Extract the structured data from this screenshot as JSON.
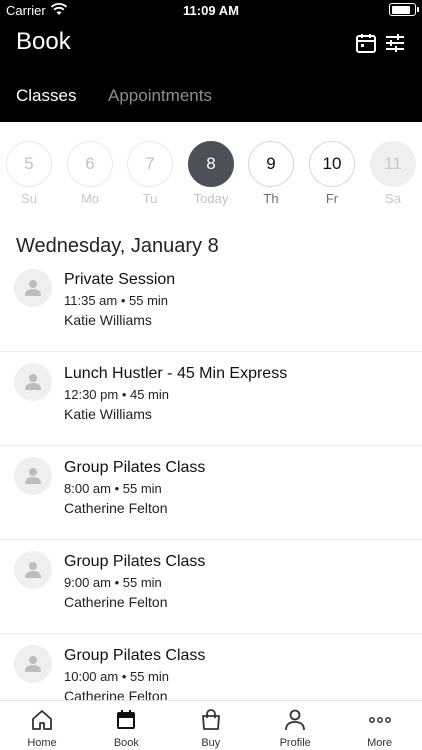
{
  "status_bar": {
    "carrier": "Carrier",
    "time": "11:09 AM",
    "battery_level": 0.9
  },
  "header": {
    "title": "Book",
    "icons": [
      "calendar-icon",
      "filter-sliders-icon"
    ],
    "tabs": [
      {
        "label": "Classes",
        "selected": true
      },
      {
        "label": "Appointments",
        "selected": false
      }
    ]
  },
  "week": [
    {
      "num": "5",
      "label": "Su",
      "state": "past"
    },
    {
      "num": "6",
      "label": "Mo",
      "state": "past"
    },
    {
      "num": "7",
      "label": "Tu",
      "state": "past"
    },
    {
      "num": "8",
      "label": "Today",
      "state": "selected"
    },
    {
      "num": "9",
      "label": "Th",
      "state": "active"
    },
    {
      "num": "10",
      "label": "Fr",
      "state": "active"
    },
    {
      "num": "11",
      "label": "Sa",
      "state": "disabled"
    }
  ],
  "date_heading": "Wednesday, January 8",
  "classes": [
    {
      "title": "Private Session",
      "time": "11:35 am • 55 min",
      "staff": "Katie Williams"
    },
    {
      "title": "Lunch Hustler - 45 Min Express",
      "time": "12:30 pm • 45 min",
      "staff": "Katie Williams"
    },
    {
      "title": "Group Pilates Class",
      "time": "8:00 am • 55 min",
      "staff": "Catherine Felton"
    },
    {
      "title": "Group Pilates Class",
      "time": "9:00 am • 55 min",
      "staff": "Catherine Felton"
    },
    {
      "title": "Group Pilates Class",
      "time": "10:00 am • 55 min",
      "staff": "Catherine Felton"
    }
  ],
  "tab_bar": [
    {
      "label": "Home",
      "icon": "home-icon"
    },
    {
      "label": "Book",
      "icon": "calendar-icon",
      "selected": true
    },
    {
      "label": "Buy",
      "icon": "shopping-bag-icon"
    },
    {
      "label": "Profile",
      "icon": "person-icon"
    },
    {
      "label": "More",
      "icon": "more-dots-icon"
    }
  ],
  "colors": {
    "header_bg": "#000000",
    "selected_day": "#4d4f59",
    "avatar_bg": "#efefef"
  }
}
